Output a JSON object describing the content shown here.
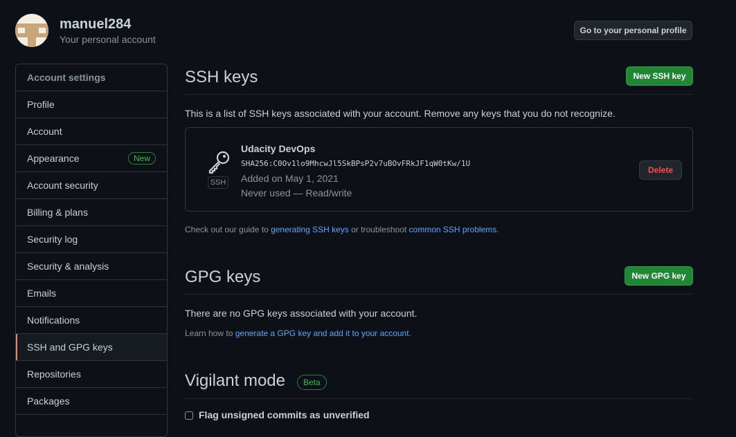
{
  "header": {
    "username": "manuel284",
    "subtitle": "Your personal account",
    "profile_button": "Go to your personal profile"
  },
  "sidebar": {
    "header": "Account settings",
    "items": [
      {
        "label": "Profile"
      },
      {
        "label": "Account"
      },
      {
        "label": "Appearance",
        "badge": "New"
      },
      {
        "label": "Account security"
      },
      {
        "label": "Billing & plans"
      },
      {
        "label": "Security log"
      },
      {
        "label": "Security & analysis"
      },
      {
        "label": "Emails"
      },
      {
        "label": "Notifications"
      },
      {
        "label": "SSH and GPG keys",
        "selected": true
      },
      {
        "label": "Repositories"
      },
      {
        "label": "Packages"
      }
    ]
  },
  "ssh": {
    "title": "SSH keys",
    "new_button": "New SSH key",
    "description": "This is a list of SSH keys associated with your account. Remove any keys that you do not recognize.",
    "key": {
      "type_label": "SSH",
      "icon": "key-icon",
      "title": "Udacity DevOps",
      "fingerprint": "SHA256:C0Ov1lo9MhcwJl5SkBPsP2v7uBOvFRkJF1qW0tKw/1U",
      "added": "Added on May 1, 2021",
      "usage": "Never used — Read/write",
      "delete_button": "Delete"
    },
    "guide": {
      "prefix": "Check out our guide to ",
      "link1": "generating SSH keys",
      "middle": " or troubleshoot ",
      "link2": "common SSH problems",
      "suffix": "."
    }
  },
  "gpg": {
    "title": "GPG keys",
    "new_button": "New GPG key",
    "empty_text": "There are no GPG keys associated with your account.",
    "learn": {
      "prefix": "Learn how to ",
      "link": "generate a GPG key and add it to your account",
      "suffix": "."
    }
  },
  "vigilant": {
    "title": "Vigilant mode",
    "badge": "Beta",
    "checkbox_label": "Flag unsigned commits as unverified"
  },
  "colors": {
    "background": "#0d1117",
    "accent_green": "#238636",
    "link": "#58a6ff",
    "danger": "#f85149",
    "selected_marker": "#f78166"
  }
}
